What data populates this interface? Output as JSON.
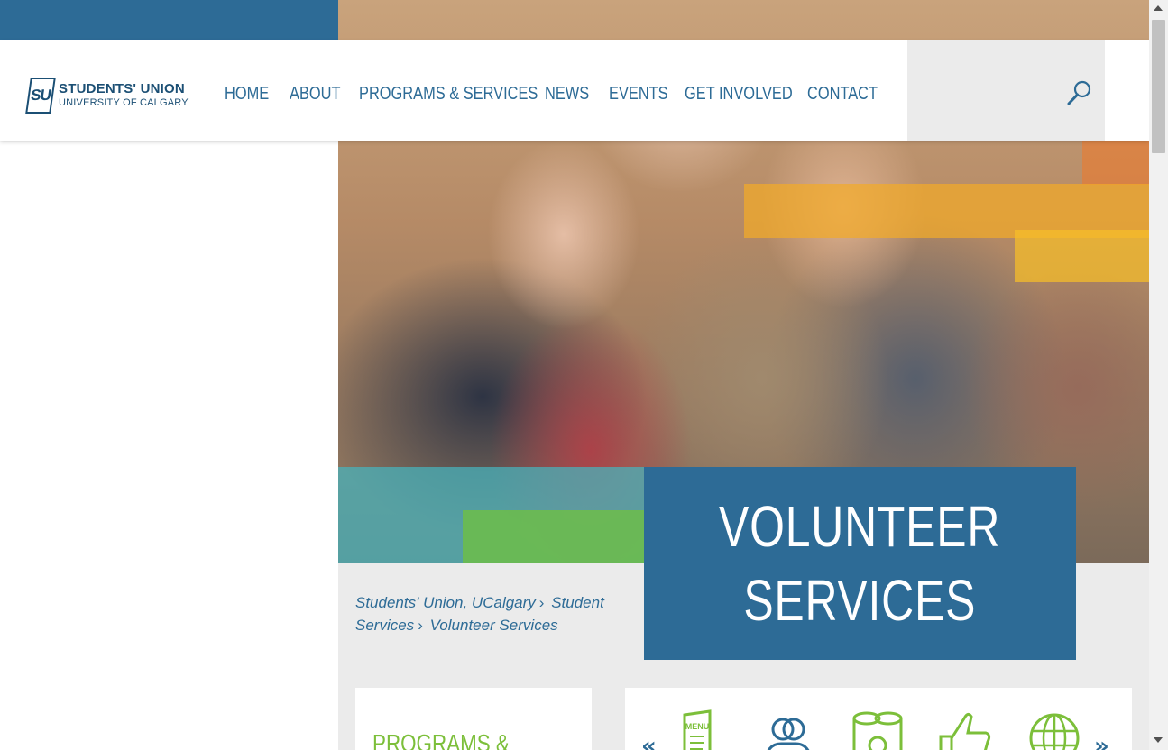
{
  "logo": {
    "mark": "SU",
    "line1": "STUDENTS' UNION",
    "line2": "UNIVERSITY OF CALGARY"
  },
  "nav": {
    "items": [
      {
        "label": "HOME"
      },
      {
        "label": "ABOUT"
      },
      {
        "label": "PROGRAMS & SERVICES"
      },
      {
        "label": "NEWS"
      },
      {
        "label": "EVENTS"
      },
      {
        "label": "GET INVOLVED"
      },
      {
        "label": "CONTACT"
      }
    ]
  },
  "search": {
    "icon": "search-icon"
  },
  "hero": {
    "title_line1": "VOLUNTEER",
    "title_line2": "SERVICES"
  },
  "breadcrumb": {
    "items": [
      {
        "label": "Students' Union, UCalgary"
      },
      {
        "label": "Student Services"
      },
      {
        "label": "Volunteer Services"
      }
    ]
  },
  "sidebar_card": {
    "title": "PROGRAMS &"
  },
  "icon_carousel": {
    "prev": "«",
    "next": "»",
    "icons": [
      {
        "name": "menu-icon",
        "label": "MENU"
      },
      {
        "name": "people-icon"
      },
      {
        "name": "film-reels-icon"
      },
      {
        "name": "thumbs-up-icon"
      },
      {
        "name": "globe-icon"
      }
    ]
  },
  "colors": {
    "brand_blue": "#2d6b96",
    "dark_blue": "#1b4f74",
    "accent_green": "#7cbf3a",
    "panel_gray": "#ebebeb"
  }
}
